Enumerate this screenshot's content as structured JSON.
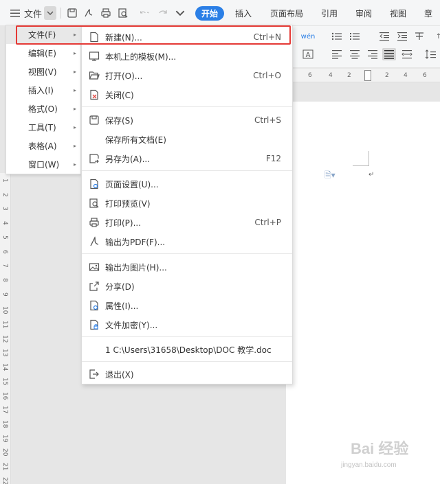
{
  "toolbar": {
    "file_label": "文件",
    "tabs": [
      "开始",
      "插入",
      "页面布局",
      "引用",
      "审阅",
      "视图",
      "章"
    ]
  },
  "main_menu": {
    "items": [
      {
        "label": "文件(F)"
      },
      {
        "label": "编辑(E)"
      },
      {
        "label": "视图(V)"
      },
      {
        "label": "插入(I)"
      },
      {
        "label": "格式(O)"
      },
      {
        "label": "工具(T)"
      },
      {
        "label": "表格(A)"
      },
      {
        "label": "窗口(W)"
      }
    ]
  },
  "file_menu": {
    "items": [
      {
        "label": "新建(N)...",
        "shortcut": "Ctrl+N",
        "icon": "new-doc-icon"
      },
      {
        "label": "本机上的模板(M)...",
        "shortcut": "",
        "icon": "template-icon"
      },
      {
        "label": "打开(O)...",
        "shortcut": "Ctrl+O",
        "icon": "open-folder-icon"
      },
      {
        "label": "关闭(C)",
        "shortcut": "",
        "icon": "close-doc-icon"
      },
      {
        "label": "保存(S)",
        "shortcut": "Ctrl+S",
        "icon": "save-icon"
      },
      {
        "label": "保存所有文档(E)",
        "shortcut": "",
        "icon": ""
      },
      {
        "label": "另存为(A)...",
        "shortcut": "F12",
        "icon": "save-as-icon"
      },
      {
        "label": "页面设置(U)...",
        "shortcut": "",
        "icon": "page-setup-icon"
      },
      {
        "label": "打印预览(V)",
        "shortcut": "",
        "icon": "print-preview-icon"
      },
      {
        "label": "打印(P)...",
        "shortcut": "Ctrl+P",
        "icon": "print-icon"
      },
      {
        "label": "输出为PDF(F)...",
        "shortcut": "",
        "icon": "pdf-icon"
      },
      {
        "label": "输出为图片(H)...",
        "shortcut": "",
        "icon": "image-icon"
      },
      {
        "label": "分享(D)",
        "shortcut": "",
        "icon": "share-icon"
      },
      {
        "label": "属性(I)...",
        "shortcut": "",
        "icon": "properties-icon"
      },
      {
        "label": "文件加密(Y)...",
        "shortcut": "",
        "icon": "encrypt-icon"
      },
      {
        "label": "1 C:\\Users\\31658\\Desktop\\DOC 教学.doc",
        "shortcut": "",
        "icon": ""
      },
      {
        "label": "退出(X)",
        "shortcut": "",
        "icon": "exit-icon"
      }
    ]
  },
  "ruler": {
    "h_ticks": [
      "6",
      "4",
      "2",
      "2",
      "4",
      "6"
    ],
    "v_ticks": [
      "1",
      "2",
      "3",
      "4",
      "5",
      "6",
      "7",
      "8",
      "9",
      "10",
      "11",
      "12",
      "13",
      "14",
      "15",
      "16",
      "17",
      "18",
      "19",
      "20",
      "21",
      "22"
    ]
  },
  "watermark": {
    "brand": "Bai 经验",
    "url": "jingyan.baidu.com"
  },
  "colors": {
    "accent": "#2b7fe6",
    "highlight": "#e53935"
  }
}
